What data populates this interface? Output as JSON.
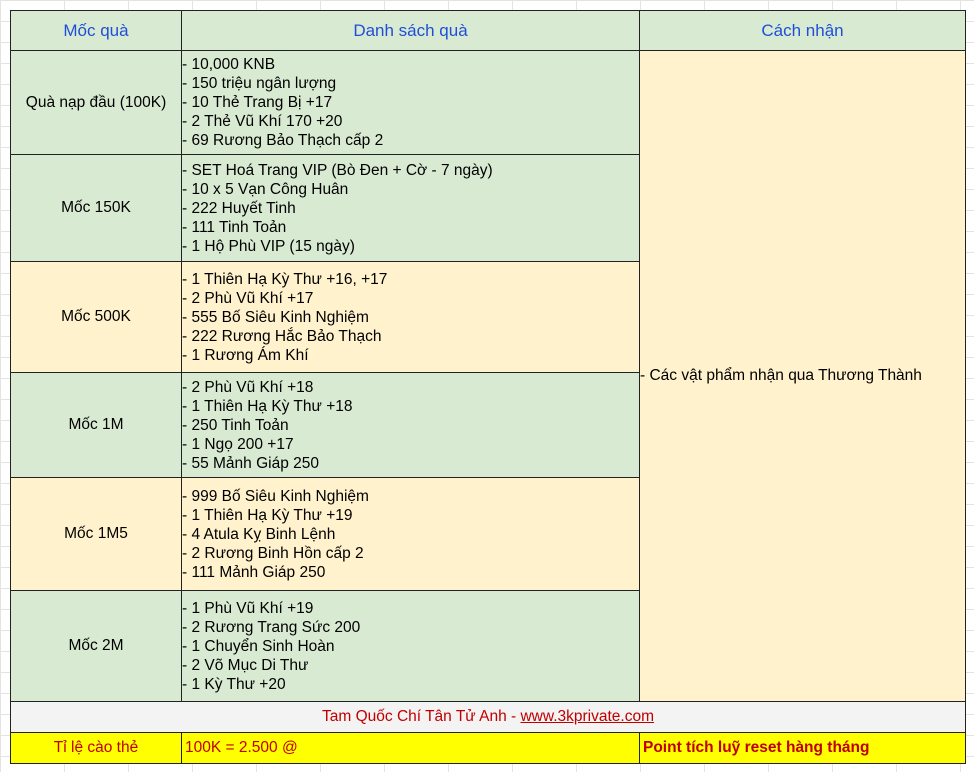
{
  "headers": {
    "col1": "Mốc quà",
    "col2": "Danh sách quà",
    "col3": "Cách nhận"
  },
  "tiers": [
    {
      "label": "Quà nạp đầu (100K)",
      "items": [
        "- 10,000 KNB",
        "- 150 triệu ngân lượng",
        "- 10 Thẻ Trang Bị +17",
        "- 2 Thẻ Vũ Khí 170 +20",
        "- 69 Rương Bảo Thạch cấp 2"
      ]
    },
    {
      "label": "Mốc 150K",
      "items": [
        "- SET Hoá Trang VIP (Bò Đen + Cờ - 7 ngày)",
        "- 10 x 5 Vạn Công Huân",
        "- 222 Huyết Tinh",
        "- 111 Tinh Toản",
        "- 1 Hộ Phù VIP (15 ngày)"
      ]
    },
    {
      "label": "Mốc 500K",
      "items": [
        "- 1 Thiên Hạ Kỳ Thư +16, +17",
        "- 2 Phù Vũ Khí +17",
        "- 555 Bố Siêu Kinh Nghiệm",
        "- 222 Rương Hắc Bảo Thạch",
        "- 1 Rương Ám Khí"
      ]
    },
    {
      "label": "Mốc 1M",
      "items": [
        "- 2 Phù Vũ Khí +18",
        "- 1 Thiên Hạ Kỳ Thư +18",
        "- 250 Tinh Toản",
        "- 1 Ngọ 200 +17",
        "- 55 Mảnh Giáp 250"
      ]
    },
    {
      "label": "Mốc 1M5",
      "items": [
        "- 999 Bố Siêu Kinh Nghiệm",
        "- 1 Thiên Hạ Kỳ Thư +19",
        "- 4 Atula Kỵ Binh Lệnh",
        "- 2 Rương Binh Hồn cấp 2",
        "- 111 Mảnh Giáp 250"
      ]
    },
    {
      "label": "Mốc 2M",
      "items": [
        "- 1 Phù Vũ Khí +19",
        "- 2 Rương Trang Sức 200",
        "- 1 Chuyển Sinh Hoàn",
        "- 2 Võ Mục Di Thư",
        "- 1 Kỳ Thư +20"
      ]
    }
  ],
  "claim_method": "- Các vật phẩm nhận qua Thương Thành",
  "footer": {
    "text": "Tam Quốc Chí Tân Tử Anh - ",
    "link": "www.3kprivate.com"
  },
  "rate_row": {
    "label": "Tỉ lệ cào thẻ",
    "value": "100K = 2.500 @",
    "note": "Point tích luỹ reset hàng tháng"
  },
  "colors": {
    "header_text": "#1f4fd8",
    "green_fill": "#d9ead3",
    "cream_fill": "#fff2cc",
    "highlight_yellow": "#ffff00",
    "red_text": "#c00000"
  }
}
